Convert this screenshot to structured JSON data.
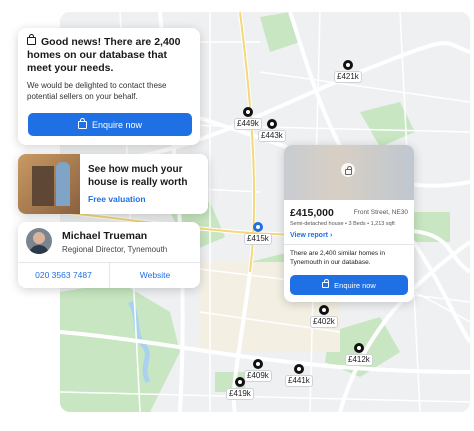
{
  "price_pins": [
    {
      "label": "£421k"
    },
    {
      "label": "£449k"
    },
    {
      "label": "£443k"
    },
    {
      "label": "£415k"
    },
    {
      "label": "£402k"
    },
    {
      "label": "£412k"
    },
    {
      "label": "£409k"
    },
    {
      "label": "£441k"
    },
    {
      "label": "£419k"
    }
  ],
  "good_news_card": {
    "title": "Good news! There are 2,400 homes on our database that meet your needs.",
    "body": "We would be delighted to contact these potential sellers on your behalf.",
    "button": "Enquire now"
  },
  "valuation_card": {
    "title": "See how much your house is really worth",
    "link": "Free valuation"
  },
  "agent_card": {
    "name": "Michael Trueman",
    "role": "Regional Director, Tynemouth",
    "phone": "020 3563 7487",
    "website": "Website"
  },
  "property_card": {
    "price": "£415,000",
    "address": "Front Street, NE30",
    "details": "Semi-detached house • 3 Beds • 1,213 sqft",
    "view_report": "View report",
    "similar": "There are 2,400 similar homes in Tynemouth in our database.",
    "button": "Enquire now"
  },
  "colors": {
    "accent": "#1f6fe5",
    "park": "#b9e0b4",
    "water": "#a9d2f0"
  }
}
